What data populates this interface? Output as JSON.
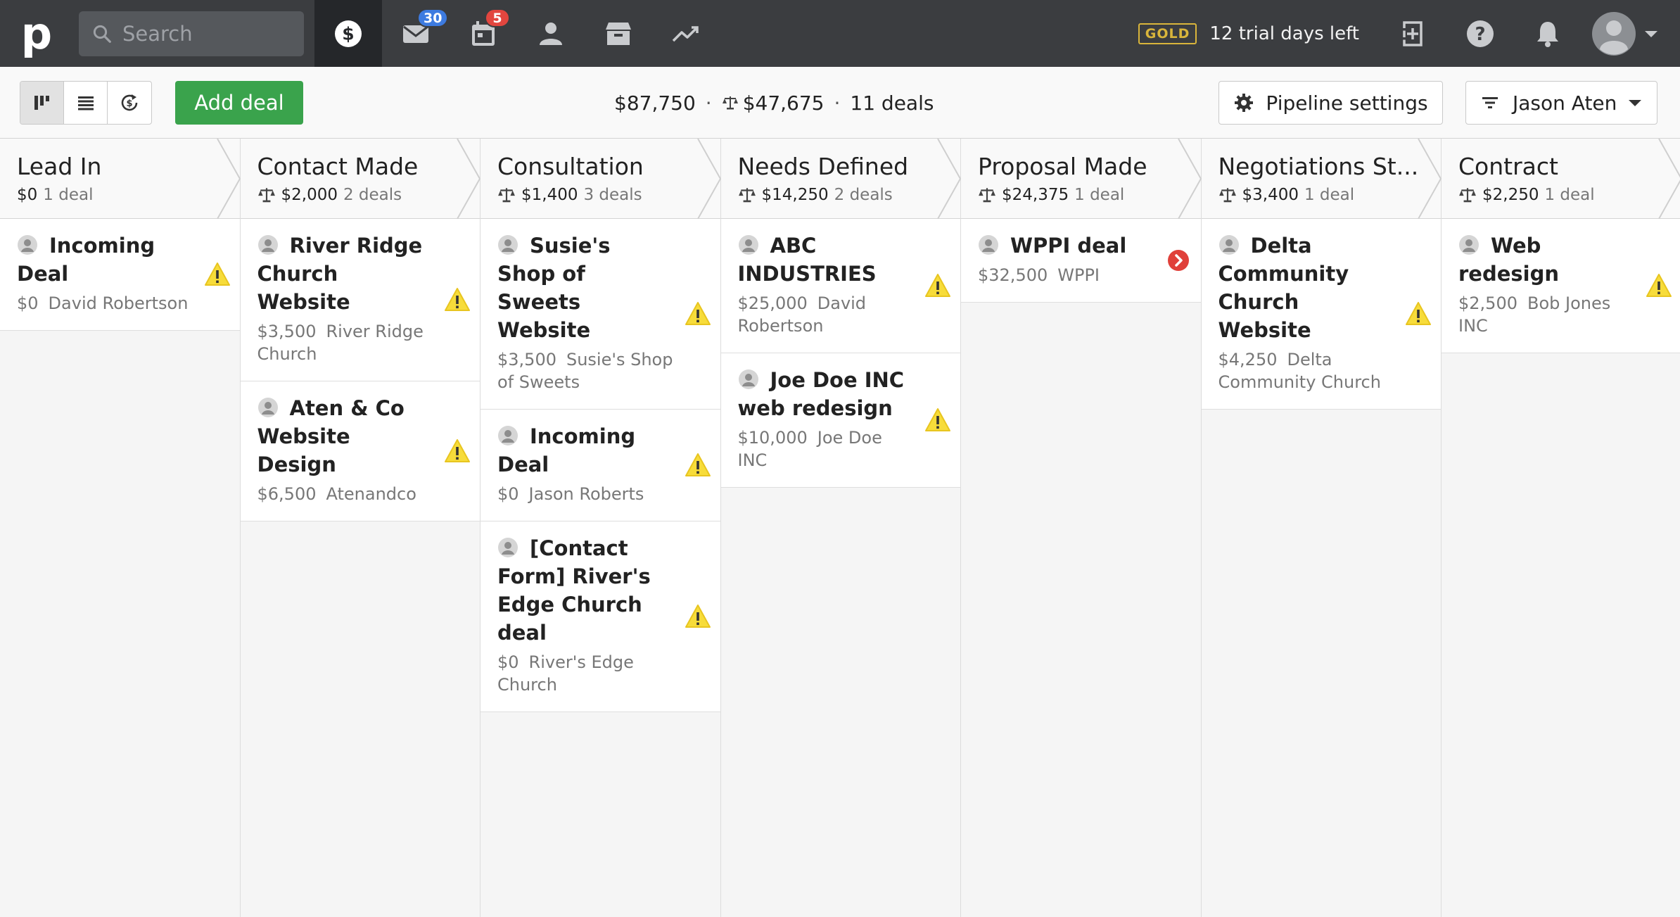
{
  "nav": {
    "search_placeholder": "Search",
    "mail_badge": "30",
    "calendar_badge": "5",
    "plan_badge": "GOLD",
    "trial_text": "12 trial days left"
  },
  "toolbar": {
    "add_deal_label": "Add deal",
    "total_value": "$87,750",
    "weighted_value": "$47,675",
    "deal_count": "11 deals",
    "pipeline_settings_label": "Pipeline settings",
    "user_filter_label": "Jason Aten"
  },
  "stages": [
    {
      "name": "Lead In",
      "value": "$0",
      "count": "1 deal",
      "deals": [
        {
          "title": "Incoming Deal",
          "value": "$0",
          "org": "David Robertson",
          "status": "warning"
        }
      ]
    },
    {
      "name": "Contact Made",
      "value": "$2,000",
      "count": "2 deals",
      "deals": [
        {
          "title": "River Ridge Church Website",
          "value": "$3,500",
          "org": "River Ridge Church",
          "status": "warning"
        },
        {
          "title": "Aten & Co Website Design",
          "value": "$6,500",
          "org": "Atenandco",
          "status": "warning"
        }
      ]
    },
    {
      "name": "Consultation",
      "value": "$1,400",
      "count": "3 deals",
      "deals": [
        {
          "title": "Susie's Shop of Sweets Website",
          "value": "$3,500",
          "org": "Susie's Shop of Sweets",
          "status": "warning"
        },
        {
          "title": "Incoming Deal",
          "value": "$0",
          "org": "Jason Roberts",
          "status": "warning"
        },
        {
          "title": "[Contact Form] River's Edge Church deal",
          "value": "$0",
          "org": "River's Edge Church",
          "status": "warning"
        }
      ]
    },
    {
      "name": "Needs Defined",
      "value": "$14,250",
      "count": "2 deals",
      "deals": [
        {
          "title": "ABC INDUSTRIES",
          "value": "$25,000",
          "org": "David Robertson",
          "status": "warning"
        },
        {
          "title": "Joe Doe INC web redesign",
          "value": "$10,000",
          "org": "Joe Doe INC",
          "status": "warning"
        }
      ]
    },
    {
      "name": "Proposal Made",
      "value": "$24,375",
      "count": "1 deal",
      "deals": [
        {
          "title": "WPPI deal",
          "value": "$32,500",
          "org": "WPPI",
          "status": "overdue"
        }
      ]
    },
    {
      "name": "Negotiations St...",
      "value": "$3,400",
      "count": "1 deal",
      "deals": [
        {
          "title": "Delta Community Church Website",
          "value": "$4,250",
          "org": "Delta Community Church",
          "status": "warning"
        }
      ]
    },
    {
      "name": "Contract",
      "value": "$2,250",
      "count": "1 deal",
      "deals": [
        {
          "title": "Web redesign",
          "value": "$2,500",
          "org": "Bob Jones INC",
          "status": "warning"
        }
      ]
    }
  ],
  "colors": {
    "topbar": "#3b3d40",
    "accent_green": "#3aa34c",
    "warning": "#f7dc3a",
    "overdue": "#e0403a"
  }
}
